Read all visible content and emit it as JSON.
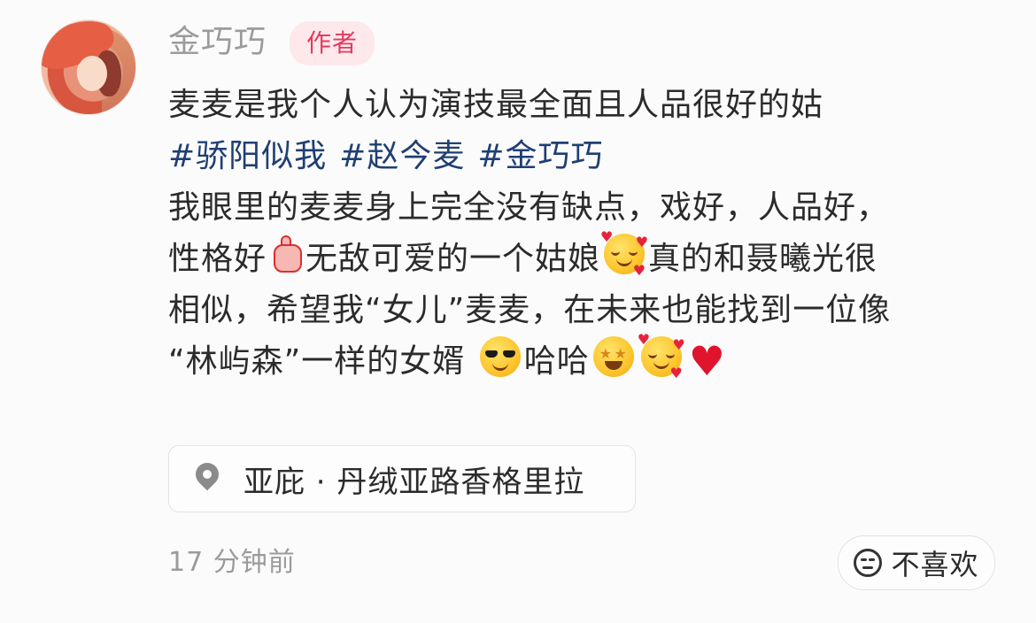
{
  "post": {
    "username": "金巧巧",
    "author_badge": "作者",
    "line1": "麦麦是我个人认为演技最全面且人品很好的姑",
    "tags": [
      "#骄阳似我",
      "#赵今麦",
      "#金巧巧"
    ],
    "line3": "我眼里的麦麦身上完全没有缺点，戏好，人品好，",
    "line4a": "性格好",
    "line4b": "无敌可爱的一个姑娘",
    "line4c": "真的和聂曦光很",
    "line5": "相似，希望我“女儿”麦麦，在未来也能找到一位像",
    "line6a": "“林屿森”一样的女婿",
    "line6b": "哈哈",
    "emojis": [
      "thumbs-up-emoji",
      "smiling-face-with-hearts-emoji",
      "sunglasses-emoji",
      "star-struck-emoji",
      "smiling-face-with-hearts-emoji",
      "red-heart-emoji"
    ]
  },
  "location": {
    "label": "亚庇 · 丹绒亚路香格里拉",
    "icon": "location-pin-icon"
  },
  "footer": {
    "timestamp": "17 分钟前",
    "dislike_label": "不喜欢",
    "dislike_icon": "neutral-face-icon"
  },
  "colors": {
    "tag": "#1f3f73",
    "badge_text": "#e5395c",
    "badge_bg": "#fde9ec",
    "muted": "#9b9b9b"
  }
}
